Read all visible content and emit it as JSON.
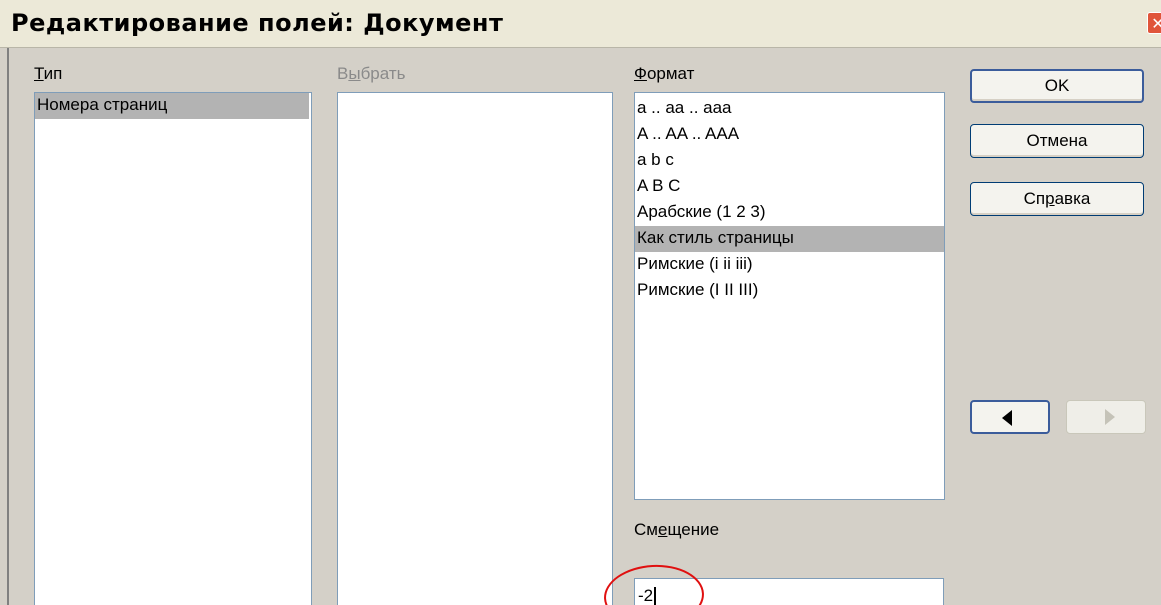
{
  "window": {
    "title": "Редактирование полей: Документ",
    "close_glyph": "✕"
  },
  "type_column": {
    "label_accel": "Т",
    "label_rest": "ип",
    "items": [
      {
        "label": "Номера страниц",
        "selected": true
      }
    ]
  },
  "select_column": {
    "label_start": "В",
    "label_accel": "ы",
    "label_rest": "брать",
    "disabled": true
  },
  "format_column": {
    "label_accel": "Ф",
    "label_rest": "ормат",
    "items": [
      {
        "label": "a .. aa .. aaa",
        "selected": false
      },
      {
        "label": "A .. AA .. AAA",
        "selected": false
      },
      {
        "label": "a b c",
        "selected": false
      },
      {
        "label": "A B C",
        "selected": false
      },
      {
        "label": "Арабские (1 2 3)",
        "selected": false
      },
      {
        "label": "Как стиль страницы",
        "selected": true
      },
      {
        "label": "Римские (i ii iii)",
        "selected": false
      },
      {
        "label": "Римские (I II III)",
        "selected": false
      }
    ]
  },
  "offset": {
    "label_start": "См",
    "label_accel": "е",
    "label_rest": "щение",
    "value": "-2"
  },
  "buttons": {
    "ok": "OK",
    "cancel": "Отмена",
    "help_start": "Сп",
    "help_accel": "р",
    "help_rest": "авка"
  },
  "colors": {
    "dialog_bg": "#d4d0c8",
    "selection": "#b3b3b3",
    "annotation": "#e01010"
  }
}
